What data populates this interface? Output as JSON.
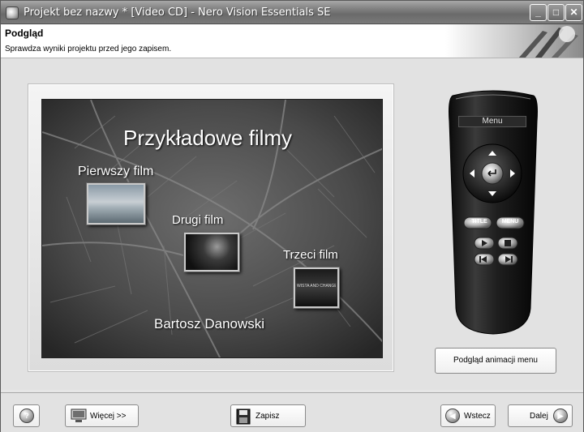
{
  "window": {
    "title": "Projekt bez nazwy * [Video CD] - Nero Vision Essentials SE"
  },
  "header": {
    "title": "Podgląd",
    "description": "Sprawdza wyniki projektu przed jego zapisem."
  },
  "preview": {
    "menu_title": "Przykładowe filmy",
    "films": [
      {
        "label": "Pierwszy film"
      },
      {
        "label": "Drugi film"
      },
      {
        "label": "Trzeci film",
        "thumb_text": "WISTA AND CHANGE"
      }
    ],
    "author": "Bartosz Danowski"
  },
  "remote": {
    "display": "Menu",
    "title_button": "TITLE",
    "menu_button": "MENU"
  },
  "actions": {
    "anim_preview": "Podgląd animacji menu"
  },
  "footer": {
    "more": "Więcej >>",
    "save": "Zapisz",
    "back": "Wstecz",
    "next": "Dalej"
  },
  "icons": {
    "help": "help-icon",
    "more": "monitor-icon",
    "save": "floppy-icon",
    "back": "arrow-left-icon",
    "next": "arrow-right-icon"
  }
}
